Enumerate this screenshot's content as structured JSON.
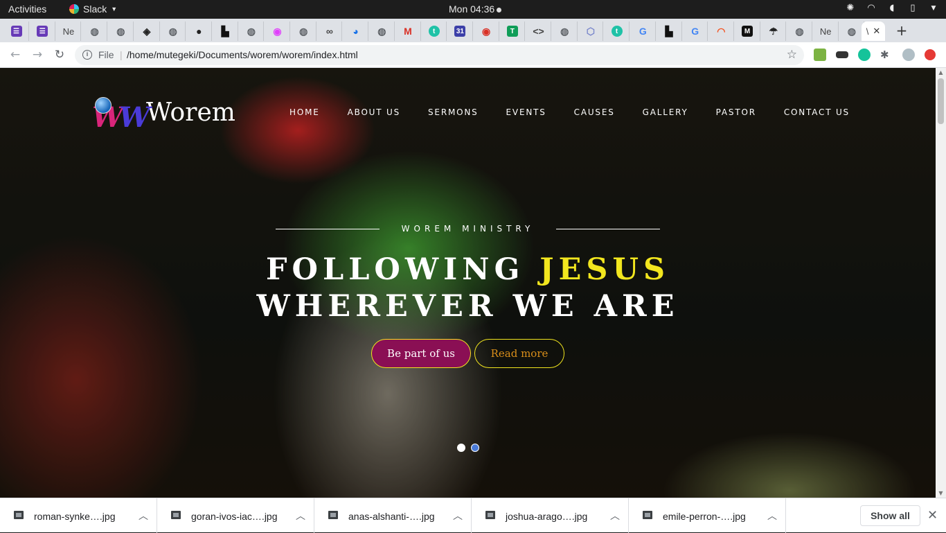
{
  "os_bar": {
    "activities": "Activities",
    "app_name": "Slack",
    "clock": "Mon 04:36"
  },
  "browser": {
    "tabs": [
      {
        "icon": "form-icon",
        "color": "#673ab7"
      },
      {
        "icon": "form-icon",
        "color": "#673ab7"
      },
      {
        "text": "Ne"
      },
      {
        "icon": "globe-icon"
      },
      {
        "icon": "globe-icon"
      },
      {
        "icon": "codepen-icon"
      },
      {
        "icon": "globe-icon"
      },
      {
        "icon": "github-icon"
      },
      {
        "icon": "unsplash-icon"
      },
      {
        "icon": "globe-icon"
      },
      {
        "icon": "color-wheel-icon"
      },
      {
        "icon": "globe-icon"
      },
      {
        "icon": "link-icon"
      },
      {
        "icon": "chrome-icon"
      },
      {
        "icon": "globe-icon"
      },
      {
        "icon": "gmail-icon"
      },
      {
        "icon": "t-icon",
        "color": "#1fc2a7"
      },
      {
        "icon": "calendar-icon",
        "color": "#3c3fa8"
      },
      {
        "icon": "record-icon"
      },
      {
        "icon": "t-square-icon",
        "color": "#0f9d58"
      },
      {
        "icon": "code-icon"
      },
      {
        "icon": "globe-icon"
      },
      {
        "icon": "hexagon-icon"
      },
      {
        "icon": "t-icon",
        "color": "#1fc2a7"
      },
      {
        "icon": "google-icon"
      },
      {
        "icon": "unsplash-icon"
      },
      {
        "icon": "google-icon"
      },
      {
        "icon": "rainbow-icon"
      },
      {
        "icon": "medium-icon"
      },
      {
        "icon": "umbrella-icon"
      },
      {
        "icon": "globe-icon"
      },
      {
        "text": "Ne"
      },
      {
        "icon": "globe-icon"
      }
    ],
    "active_tab_text": "\\",
    "omnibox": {
      "scheme_label": "File",
      "url": "/home/mutegeki/Documents/worem/worem/index.html"
    }
  },
  "site": {
    "brand": "Worem",
    "nav": [
      "HOME",
      "ABOUT US",
      "SERMONS",
      "EVENTS",
      "CAUSES",
      "GALLERY",
      "PASTOR",
      "CONTACT US"
    ],
    "kicker": "WOREM MINISTRY",
    "headline_part1": "FOLLOWING ",
    "headline_accent": "JESUS",
    "headline_line2": "WHEREVER WE ARE",
    "primary_button": "Be part of us",
    "secondary_button": "Read more",
    "slider_dots": [
      true,
      false
    ],
    "colors": {
      "accent": "#f2e61e",
      "primary": "#8a0f54",
      "secondary_text": "#d98e1a"
    }
  },
  "downloads": {
    "items": [
      "roman-synke….jpg",
      "goran-ivos-iac….jpg",
      "anas-alshanti-….jpg",
      "joshua-arago….jpg",
      "emile-perron-….jpg"
    ],
    "show_all": "Show all"
  }
}
